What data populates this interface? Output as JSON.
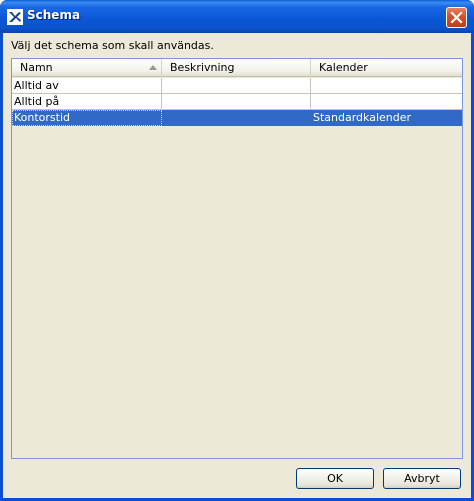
{
  "window": {
    "title": "Schema",
    "close_label": "✕"
  },
  "dialog": {
    "instruction": "Välj det schema som skall användas."
  },
  "table": {
    "columns": [
      "Namn",
      "Beskrivning",
      "Kalender"
    ],
    "sort_column": "Namn",
    "rows": [
      {
        "name": "Alltid av",
        "description": "",
        "calendar": ""
      },
      {
        "name": "Alltid på",
        "description": "",
        "calendar": ""
      },
      {
        "name": "Kontorstid",
        "description": "",
        "calendar": "Standardkalender"
      }
    ],
    "selected_row": "Kontorstid"
  },
  "buttons": {
    "ok": "OK",
    "cancel": "Avbryt"
  },
  "colors": {
    "title_bar": "#0a58d6",
    "selection": "#316ac5",
    "dialog_bg": "#ece9d8"
  }
}
